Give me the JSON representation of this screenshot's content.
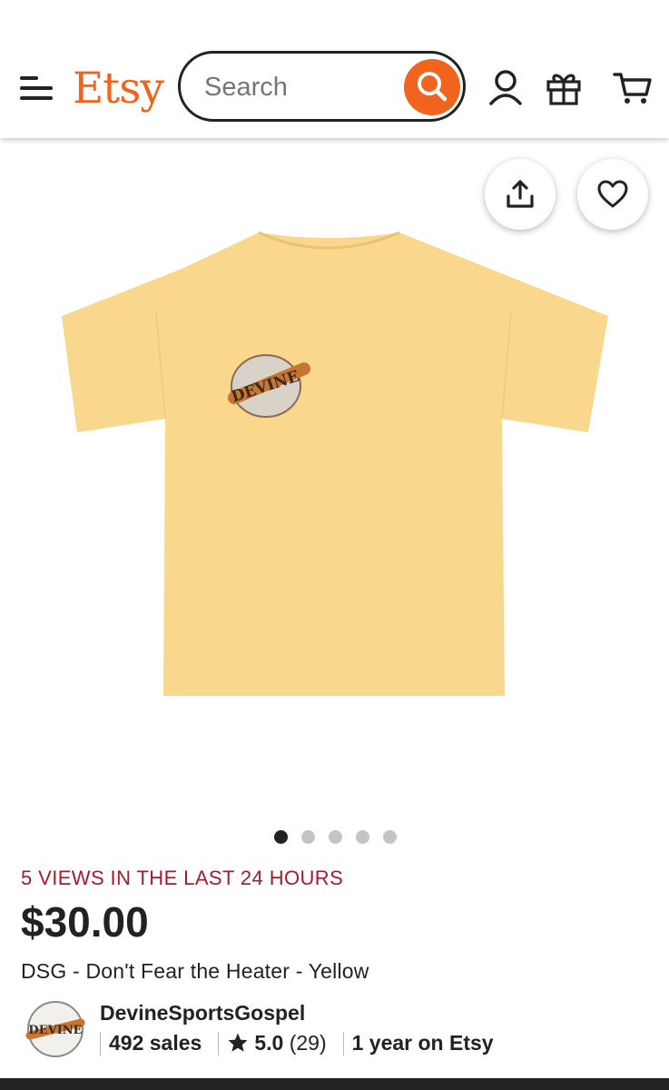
{
  "header": {
    "logo": "Etsy",
    "search": {
      "placeholder": "Search",
      "value": ""
    },
    "icons": [
      "menu-icon",
      "search-icon",
      "account-icon",
      "gift-icon",
      "cart-icon"
    ]
  },
  "image_actions": {
    "icons": [
      "share-icon",
      "heart-icon"
    ]
  },
  "gallery": {
    "total_images": 5,
    "active_index": 0
  },
  "listing": {
    "views_notice": "5 VIEWS IN THE LAST 24 HOURS",
    "price": "$30.00",
    "title": "DSG - Don't Fear the Heater - Yellow"
  },
  "shop": {
    "name": "DevineSportsGospel",
    "sales": "492 sales",
    "rating": "5.0",
    "review_count": "(29)",
    "tenure": "1 year on Etsy",
    "logo_text": "DEVINE"
  },
  "colors": {
    "brand": "#f1641e",
    "views_notice": "#a61a2e",
    "shirt": "#f9d78c",
    "text": "#222222"
  }
}
